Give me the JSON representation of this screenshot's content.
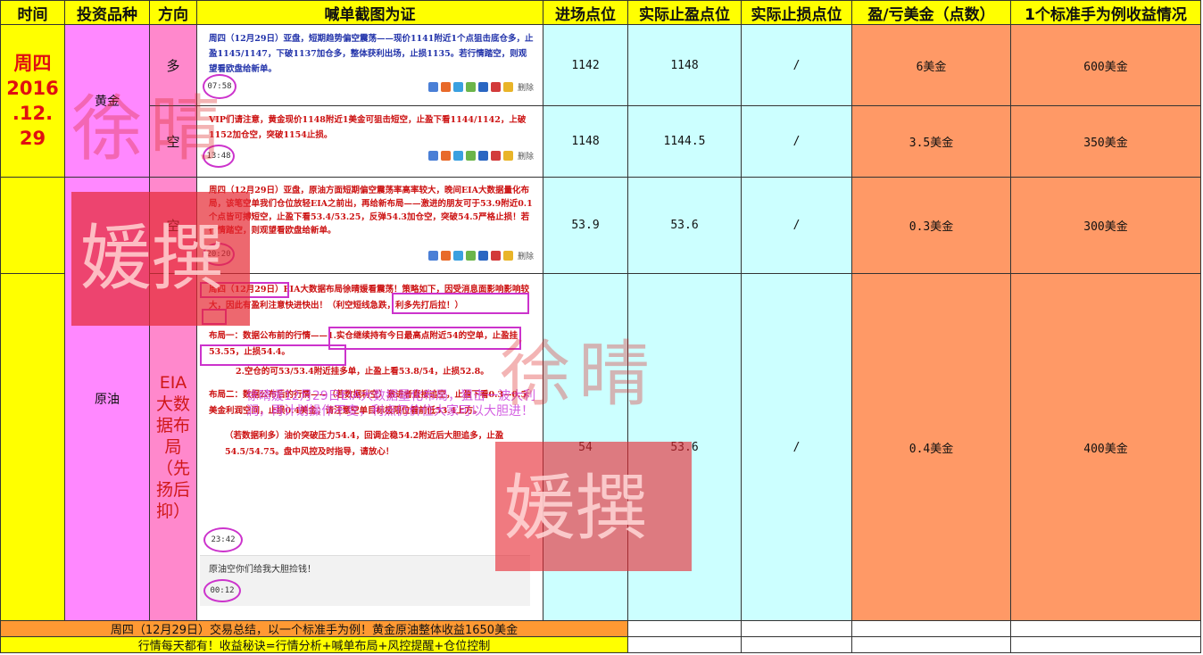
{
  "header": {
    "time": "时间",
    "instrument": "投资品种",
    "direction": "方向",
    "proof": "喊单截图为证",
    "entry": "进场点位",
    "take_profit": "实际止盈点位",
    "stop_loss": "实际止损点位",
    "pnl": "盈/亏美金（点数）",
    "profit_per_lot": "1个标准手为例收益情况"
  },
  "date_cell": {
    "line1": "周四",
    "line2": "2016",
    "line3": ".12.",
    "line4": "29"
  },
  "instruments": {
    "gold": "黄金",
    "oil": "原油"
  },
  "rows": [
    {
      "direction": "多",
      "entry": "1142",
      "take_profit": "1148",
      "stop_loss": "/",
      "pnl": "6美金",
      "profit": "600美金",
      "message": "周四（12月29日）亚盘，短期趋势偏空震荡——现价1141附近1个点狙击底仓多，止盈1145/1147，下破1137加仓多，整体获利出场，止损1135。若行情踏空，则观望看欧盘给新单。",
      "time": "07:58"
    },
    {
      "direction": "空",
      "entry": "1148",
      "take_profit": "1144.5",
      "stop_loss": "/",
      "pnl": "3.5美金",
      "profit": "350美金",
      "message": "VIP们请注意，黄金现价1148附近1美金可狙击短空，止盈下看1144/1142，上破1152加仓空，突破1154止损。",
      "time": "13:48"
    },
    {
      "direction": "空",
      "entry": "53.9",
      "take_profit": "53.6",
      "stop_loss": "/",
      "pnl": "0.3美金",
      "profit": "300美金",
      "message": "周四（12月29日）亚盘，原油方面短期偏空震荡率高率较大，晚间EIA大数据量化布局，该笔空单我们仓位放轻EIA之前出，再给新布局——激进的朋友可于53.9附近0.1个点皆可搏短空，止盈下看53.4/53.25，反弹54.3加仓空，突破54.5严格止损！若行情踏空，则观望看欧盘给新单。",
      "time": "20:20"
    },
    {
      "direction": "EIA大数据布局（先扬后抑）",
      "entry": "54",
      "take_profit": "53.6",
      "stop_loss": "/",
      "pnl": "0.4美金",
      "profit": "400美金",
      "message_parts": [
        "周四（12月29日）EIA大数据布局徐晴媛看震荡！策略如下，因受消息面影响影响较大，因此有盈利注意快进快出！（利空短线急跌，利多先打后拉！）",
        "布局一：数据公布前的行情——1.实仓继续持有今日最高点附近54的空单，止盈挂53.55，止损54.4。",
        "2.空仓的可53/53.4附近挂多单，止盈上看53.8/54，止损52.8。",
        "布局二：数据公布后的行情——（若数据利空）激进者直接追空，止盈下看0.3—0.5美金利润空间，止损0.4美金；请注意空单目标极限位看前低53.4上方。",
        "（若数据利多）油价突破压力54.4，回调企稳54.2附近后大胆追多，止盈54.5/54.75。盘中风控及时指导，请放心！"
      ],
      "overlay_text": "徐晴媛12月29日EIA大数据量化布局，狙击一波大利润，再计划操作不变，利点仍价位大家可以大胆进！",
      "time": "23:42",
      "followup": "原油空你们给我大胆捡钱！",
      "followup_time": "00:12"
    }
  ],
  "summary": {
    "line1": "周四（12月29日）交易总结，以一个标准手为例！黄金原油整体收益1650美金",
    "line2": "行情每天都有！收益秘诀=行情分析+喊单布局+风控提醒+仓位控制"
  },
  "delete_label": "删除",
  "watermark": {
    "text1": "徐晴",
    "text2": "媛撰"
  },
  "colors": {
    "header": "#ffff00",
    "instrument": "#ff88ff",
    "direction": "#ff88cc",
    "levels": "#ccffff",
    "profit": "#ff9966",
    "summary1": "#ff9933",
    "summary2": "#ffff00",
    "oval": "#cc33cc"
  }
}
